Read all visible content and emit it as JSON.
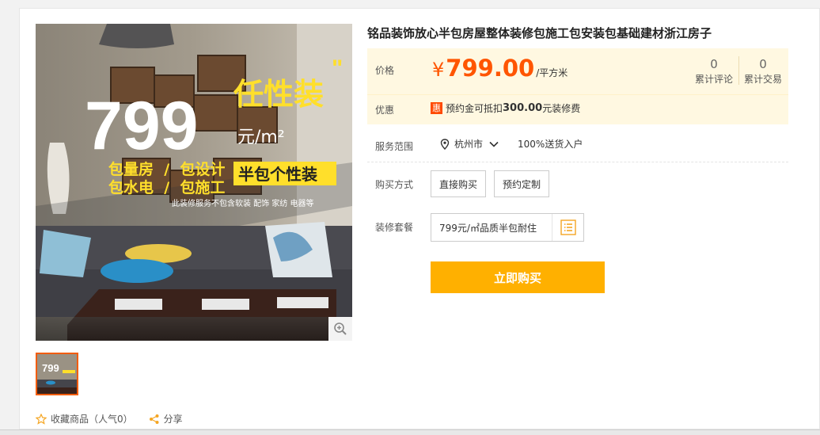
{
  "product": {
    "title": "铭品装饰放心半包房屋整体装修包施工包安装包基础建材浙江房子"
  },
  "hero": {
    "big_number": "799",
    "slogan": "任性装",
    "unit": "元/m²",
    "services_line1": "包量房  /  包设计",
    "services_line2": "包水电  /  包施工",
    "badge": "半包个性装",
    "note": "此装修服务不包含软装 配饰 家纺 电器等",
    "thumb_number": "799"
  },
  "price_section": {
    "label": "价格",
    "currency": "¥",
    "amount": "799.00",
    "unit": "/平方米",
    "stats": [
      {
        "value": "0",
        "label": "累计评论"
      },
      {
        "value": "0",
        "label": "累计交易"
      }
    ]
  },
  "promo": {
    "label": "优惠",
    "badge": "惠",
    "text_before": "预约金可抵扣",
    "amount": "300.00",
    "text_after": "元装修费"
  },
  "service": {
    "label": "服务范围",
    "city": "杭州市",
    "delivery": "100%送货入户"
  },
  "purchase": {
    "label": "购买方式",
    "options": [
      "直接购买",
      "预约定制"
    ]
  },
  "package": {
    "label": "装修套餐",
    "value": "799元/㎡品质半包耐住"
  },
  "buy_button": "立即购买",
  "actions": {
    "favorite": "收藏商品（人气0）",
    "share": "分享"
  },
  "colors": {
    "price": "#ff5500",
    "accent": "#ffb000",
    "price_bg": "#fff8e1",
    "thumb_border": "#f25c05"
  }
}
